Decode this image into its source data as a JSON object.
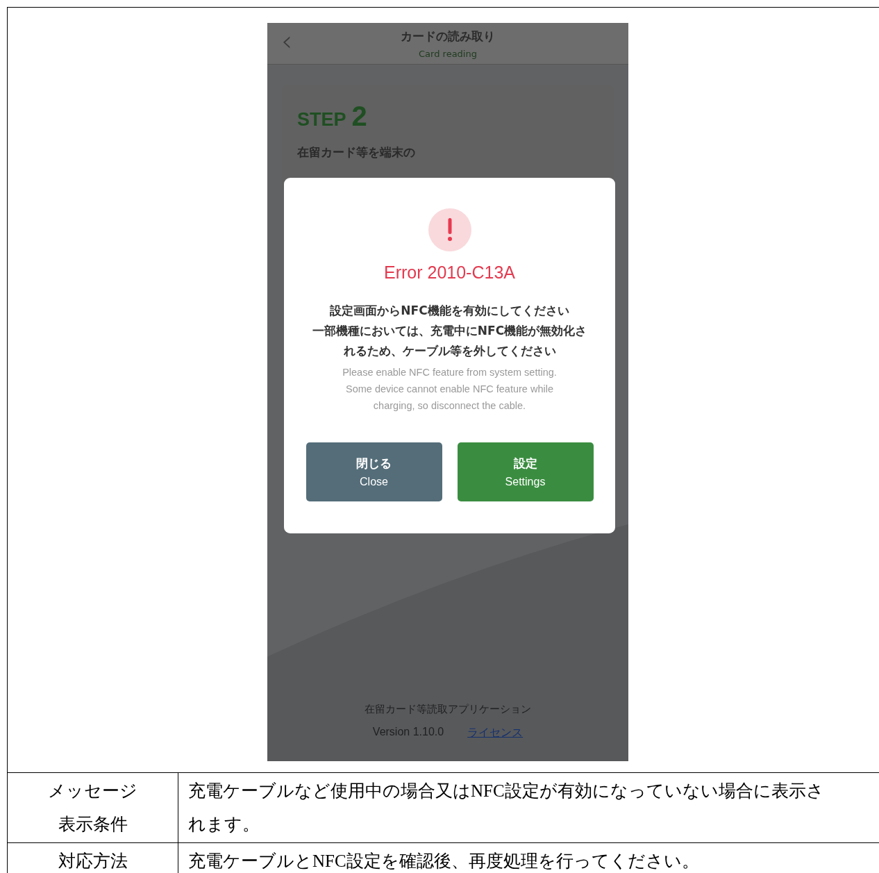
{
  "screenshot": {
    "header": {
      "back": "‹",
      "title": "カードの読み取り",
      "subtitle": "Card reading"
    },
    "step": {
      "label": "STEP",
      "number": "2",
      "instruction": "在留カード等を端末の"
    },
    "dialog": {
      "title": "Error 2010-C13A",
      "message_ja": [
        "設定画面からNFC機能を有効にしてください",
        "一部機種においては、充電中にNFC機能が無効化されるため、ケーブル等を外してください"
      ],
      "message_en": "Please enable NFC feature from system setting.\nSome device cannot enable NFC feature while\ncharging, so disconnect the cable.",
      "buttons": [
        {
          "kind": "secondary",
          "label_ja": "閉じる",
          "label_en": "Close"
        },
        {
          "kind": "primary",
          "label_ja": "設定",
          "label_en": "Settings"
        }
      ]
    },
    "footer": {
      "app_name": "在留カード等読取アプリケーション",
      "version": "Version 1.10.0",
      "link": "ライセンス"
    }
  },
  "table": {
    "rows": [
      {
        "label": [
          "メッセージ",
          "表示条件"
        ],
        "text": "充電ケーブルなど使用中の場合又はNFC設定が有効になっていない場合に表示されます。"
      },
      {
        "label": "対応方法",
        "text": "充電ケーブルとNFC設定を確認後、再度処理を行ってください。"
      }
    ]
  }
}
